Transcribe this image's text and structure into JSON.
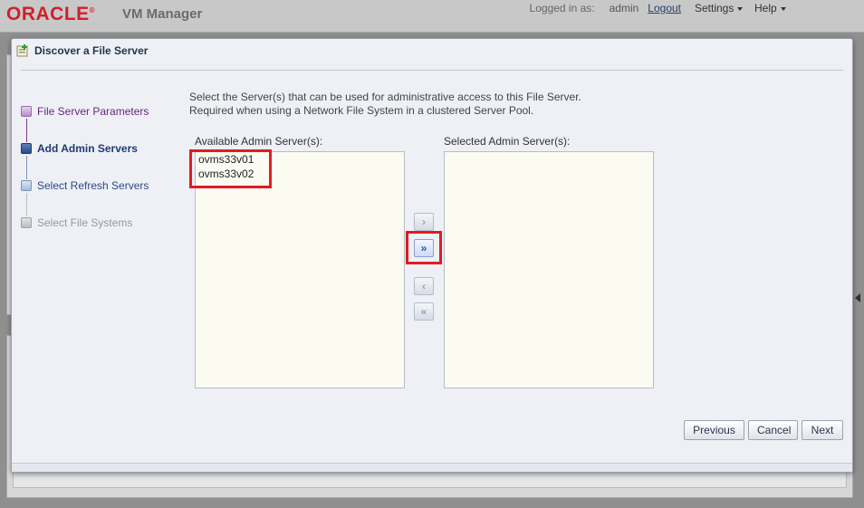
{
  "app": {
    "brand": "ORACLE",
    "product": "VM Manager",
    "logged_in_label": "Logged in as:",
    "username": "admin",
    "logout_label": "Logout",
    "menus": [
      {
        "label": "Settings"
      },
      {
        "label": "Help"
      }
    ]
  },
  "dialog": {
    "title": "Discover a File Server",
    "steps": [
      {
        "label": "File Server Parameters",
        "state": "visited"
      },
      {
        "label": "Add Admin Servers",
        "state": "current"
      },
      {
        "label": "Select Refresh Servers",
        "state": "next"
      },
      {
        "label": "Select File Systems",
        "state": "disabled"
      }
    ],
    "instructions_line1": "Select the Server(s) that can be used for administrative access to this File Server.",
    "instructions_line2": "Required when using a Network File System in a clustered Server Pool.",
    "available_label": "Available Admin Server(s):",
    "selected_label": "Selected Admin Server(s):",
    "available_items": [
      "ovms33v01",
      "ovms33v02"
    ],
    "selected_items": [],
    "shuttle_buttons": {
      "move": "›",
      "move_all": "»",
      "remove": "‹",
      "remove_all": "«"
    },
    "buttons": {
      "previous": "Previous",
      "cancel": "Cancel",
      "next": "Next"
    }
  },
  "colors": {
    "brand_red": "#d0202a",
    "highlight_red": "#e21b23",
    "current_step_blue": "#1f3b70"
  }
}
